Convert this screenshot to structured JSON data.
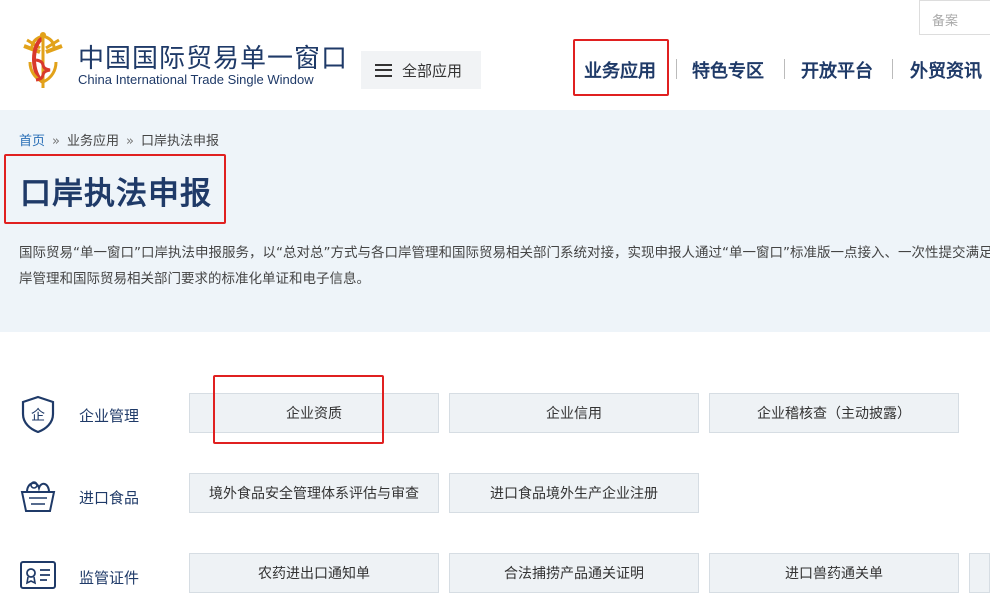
{
  "header": {
    "brand_cn": "中国国际贸易单一窗口",
    "brand_en": "China International Trade Single Window",
    "all_apps_label": "全部应用",
    "search_placeholder": "备案",
    "nav": [
      "业务应用",
      "特色专区",
      "开放平台",
      "外贸资讯"
    ]
  },
  "breadcrumb": {
    "home": "首页",
    "separator": "»",
    "level2": "业务应用",
    "current": "口岸执法申报"
  },
  "page": {
    "title": "口岸执法申报",
    "description": "国际贸易“单一窗口”口岸执法申报服务，以“总对总”方式与各口岸管理和国际贸易相关部门系统对接，实现申报人通过“单一窗口”标准版一点接入、一次性提交满足口岸管理和国际贸易相关部门要求的标准化单证和电子信息。"
  },
  "categories": [
    {
      "label": "企业管理",
      "icon": "shield-enterprise-icon",
      "items": [
        "企业资质",
        "企业信用",
        "企业稽核查（主动披露）"
      ]
    },
    {
      "label": "进口食品",
      "icon": "food-basket-icon",
      "items": [
        "境外食品安全管理体系评估与审查",
        "进口食品境外生产企业注册"
      ]
    },
    {
      "label": "监管证件",
      "icon": "certificate-icon",
      "items": [
        "农药进出口通知单",
        "合法捕捞产品通关证明",
        "进口兽药通关单"
      ]
    }
  ],
  "colors": {
    "brand": "#1f3a68",
    "highlight": "#e02020",
    "banner_bg": "#eef4f9",
    "button_bg": "#eef2f5"
  }
}
